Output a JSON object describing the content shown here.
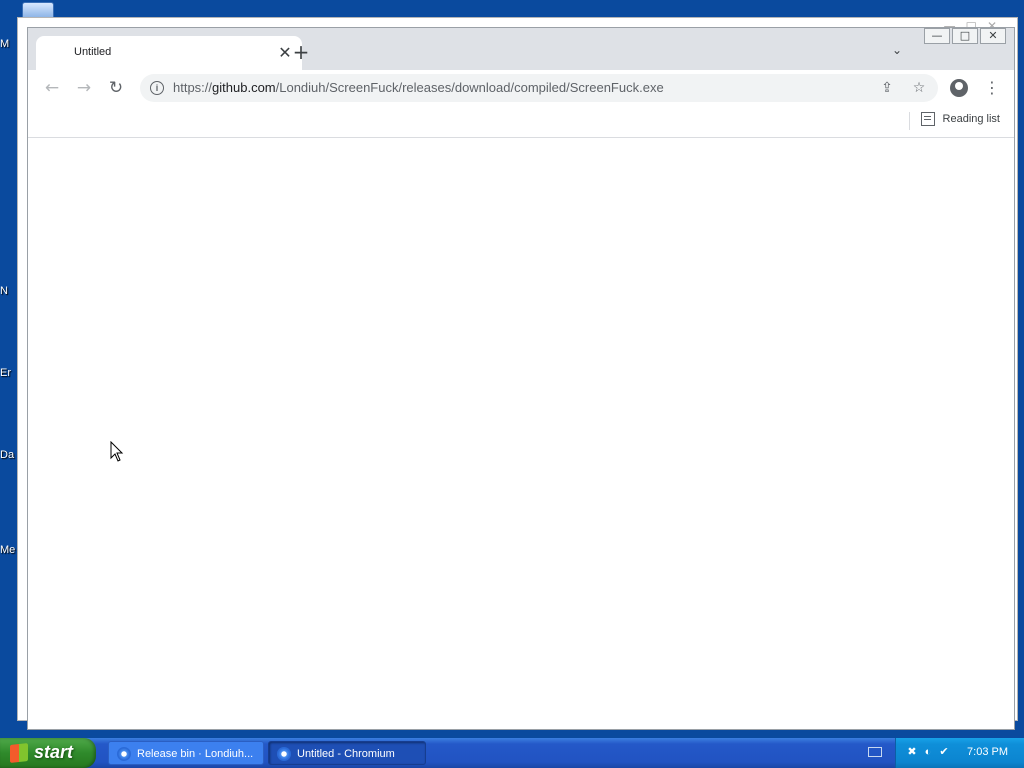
{
  "desktop": {
    "labels": [
      "M",
      "N",
      "Er",
      "Da",
      "Me"
    ]
  },
  "browser": {
    "tab": {
      "title": "Untitled",
      "close_symbol": "✕"
    },
    "new_tab_symbol": "+",
    "tab_search_symbol": "⌄",
    "window_controls": {
      "minimize": "—",
      "maximize": "□",
      "close": "✕"
    },
    "nav": {
      "back": "←",
      "forward": "→",
      "reload": "↻"
    },
    "url": {
      "prefix": "https://",
      "host": "github.com",
      "path": "/Londiuh/ScreenFuck/releases/download/compiled/ScreenFuck.exe"
    },
    "omnibox_icons": {
      "share": "⇪",
      "bookmark": "☆"
    },
    "menu_symbol": "⋮",
    "reading_list_label": "Reading list"
  },
  "taskbar": {
    "start_label": "start",
    "buttons": [
      {
        "label": "Release bin · Londiuh...",
        "active": false
      },
      {
        "label": "Untitled - Chromium",
        "active": true
      }
    ],
    "clock": "7:03 PM"
  },
  "colors": {
    "desktop_bg": "#0a4a9e",
    "tabstrip_bg": "#dee1e6",
    "omnibox_bg": "#f1f3f4",
    "taskbar_bg": "#2153c2",
    "start_green": "#2f8a2b"
  }
}
